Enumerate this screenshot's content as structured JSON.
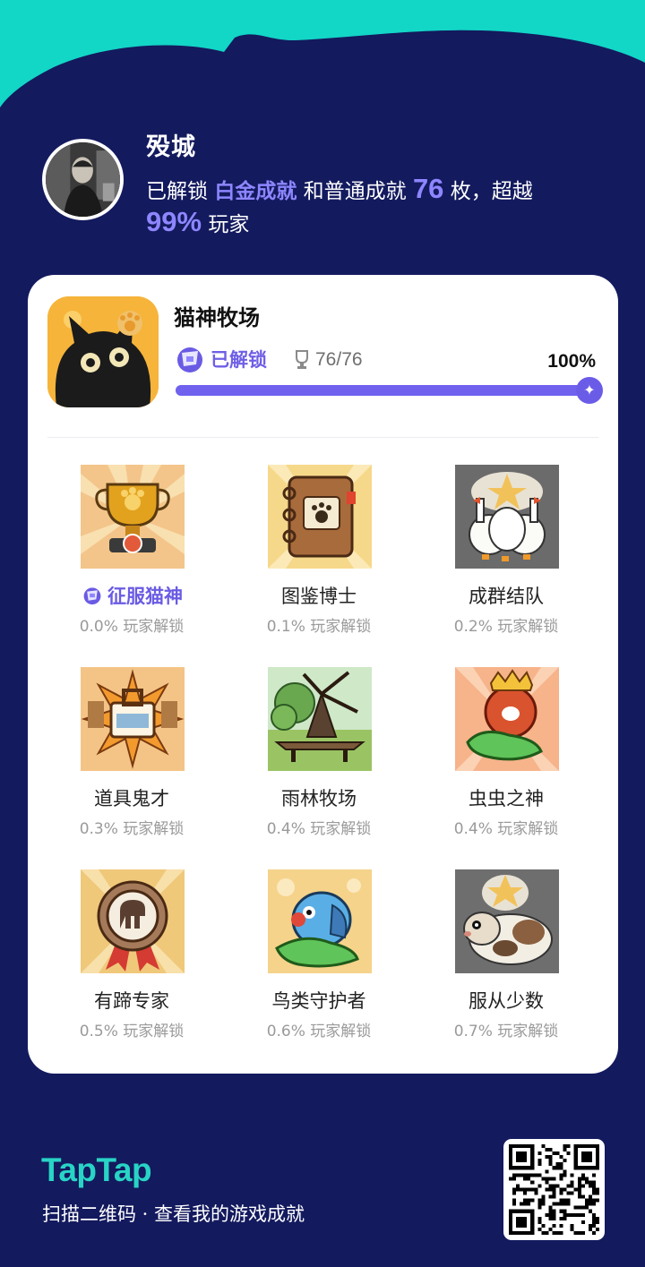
{
  "colors": {
    "background": "#131a5e",
    "wave": "#12d6c6",
    "accent": "#7062ee",
    "brand": "#28d4c5"
  },
  "profile": {
    "name": "殁城",
    "line1_prefix": "已解锁",
    "platinum_text": "白金成就",
    "line1_mid": "和普通成就",
    "count": "76",
    "line1_suffix": "枚，超越",
    "percent": "99%",
    "line2_suffix": "玩家"
  },
  "game": {
    "title": "猫神牧场",
    "status": "已解锁",
    "count": "76/76",
    "percent_label": "100%",
    "progress": 1.0
  },
  "achievements": [
    {
      "name": "征服猫神",
      "stat": "0.0% 玩家解锁",
      "platinum": true,
      "icon": "golden-paw-trophy-icon"
    },
    {
      "name": "图鉴博士",
      "stat": "0.1% 玩家解锁",
      "platinum": false,
      "icon": "paw-notebook-icon"
    },
    {
      "name": "成群结队",
      "stat": "0.2% 玩家解锁",
      "platinum": false,
      "icon": "goose-flock-icon"
    },
    {
      "name": "道具鬼才",
      "stat": "0.3% 玩家解锁",
      "platinum": false,
      "icon": "tool-crate-burst-icon"
    },
    {
      "name": "雨林牧场",
      "stat": "0.4% 玩家解锁",
      "platinum": false,
      "icon": "rainforest-windmill-icon"
    },
    {
      "name": "虫虫之神",
      "stat": "0.4% 玩家解锁",
      "platinum": false,
      "icon": "crowned-bug-hand-icon"
    },
    {
      "name": "有蹄专家",
      "stat": "0.5% 玩家解锁",
      "platinum": false,
      "icon": "hoof-medal-icon"
    },
    {
      "name": "鸟类守护者",
      "stat": "0.6% 玩家解锁",
      "platinum": false,
      "icon": "parrot-hand-icon"
    },
    {
      "name": "服从少数",
      "stat": "0.7% 玩家解锁",
      "platinum": false,
      "icon": "guinea-pig-icon"
    }
  ],
  "footer": {
    "brand": "TapTap",
    "scan_text": "扫描二维码 · 查看我的游戏成就"
  }
}
